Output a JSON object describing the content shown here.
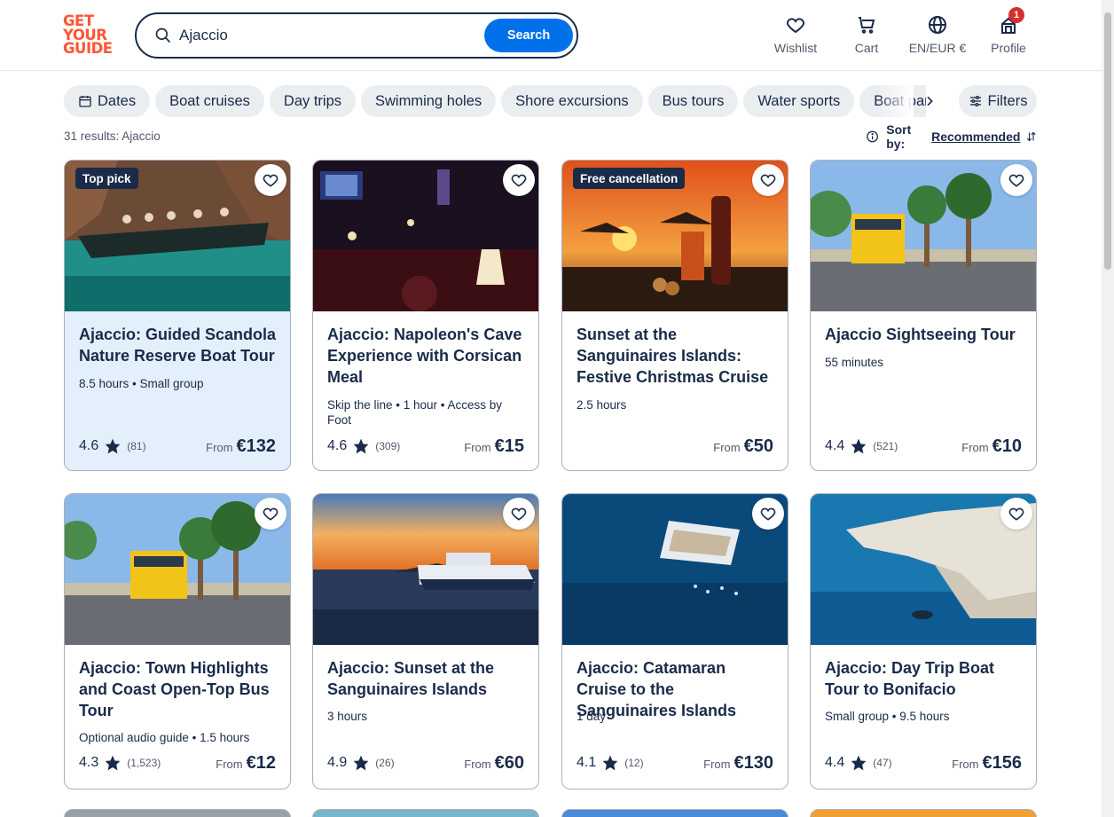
{
  "header": {
    "logo": [
      "GET",
      "YOUR",
      "GUIDE"
    ],
    "search": {
      "value": "Ajaccio",
      "button": "Search"
    },
    "nav": [
      {
        "label": "Wishlist",
        "icon": "heart-icon"
      },
      {
        "label": "Cart",
        "icon": "cart-icon"
      },
      {
        "label": "EN/EUR €",
        "icon": "globe-icon"
      },
      {
        "label": "Profile",
        "icon": "profile-icon",
        "badge": "1"
      }
    ]
  },
  "filters": {
    "chips": [
      "Dates",
      "Boat cruises",
      "Day trips",
      "Swimming holes",
      "Shore excursions",
      "Bus tours",
      "Water sports",
      "Boat parties"
    ],
    "filters_label": "Filters"
  },
  "results": {
    "count_text": "31 results: Ajaccio",
    "sort_label": "Sort by:",
    "sort_value": "Recommended"
  },
  "cards": [
    {
      "title": "Ajaccio: Guided Scandola Nature Reserve Boat Tour",
      "meta": "8.5 hours • Small group",
      "rating": "4.6",
      "reviews": "(81)",
      "from": "From",
      "price": "€132",
      "badge": "Top pick"
    },
    {
      "title": "Ajaccio: Napoleon's Cave Experience with Corsican Meal",
      "meta": "Skip the line • 1 hour • Access by Foot",
      "rating": "4.6",
      "reviews": "(309)",
      "from": "From",
      "price": "€15",
      "badge": ""
    },
    {
      "title": "Sunset at the Sanguinaires Islands: Festive Christmas Cruise",
      "meta": "2.5 hours",
      "rating": "",
      "reviews": "",
      "from": "From",
      "price": "€50",
      "badge": "Free cancellation"
    },
    {
      "title": "Ajaccio Sightseeing Tour",
      "meta": "55 minutes",
      "rating": "4.4",
      "reviews": "(521)",
      "from": "From",
      "price": "€10",
      "badge": ""
    },
    {
      "title": "Ajaccio: Town Highlights and Coast Open-Top Bus Tour",
      "meta": "Optional audio guide • 1.5 hours",
      "rating": "4.3",
      "reviews": "(1,523)",
      "from": "From",
      "price": "€12",
      "badge": ""
    },
    {
      "title": "Ajaccio: Sunset at the Sanguinaires Islands",
      "meta": "3 hours",
      "rating": "4.9",
      "reviews": "(26)",
      "from": "From",
      "price": "€60",
      "badge": ""
    },
    {
      "title": "Ajaccio: Catamaran Cruise to the Sanguinaires Islands",
      "meta": "1 day",
      "rating": "4.1",
      "reviews": "(12)",
      "from": "From",
      "price": "€130",
      "badge": ""
    },
    {
      "title": "Ajaccio: Day Trip Boat Tour to Bonifacio",
      "meta": "Small group • 9.5 hours",
      "rating": "4.4",
      "reviews": "(47)",
      "from": "From",
      "price": "€156",
      "badge": ""
    }
  ],
  "colors": {
    "primary": "#0071eb",
    "text": "#1a2b49",
    "brand": "#ff5533",
    "chip_bg": "#ebeef1",
    "highlight": "#e3f0fc",
    "badge_red": "#d52f2f"
  }
}
